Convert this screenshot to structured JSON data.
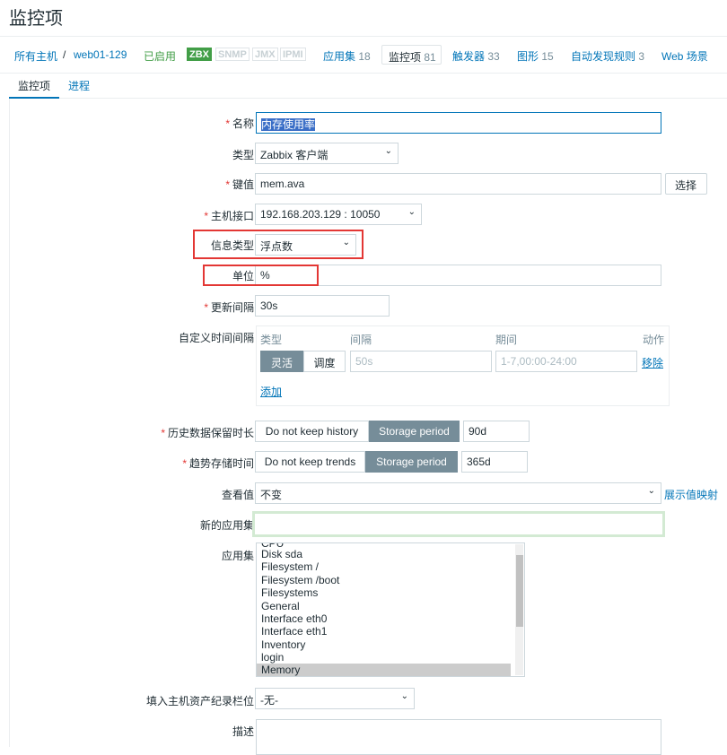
{
  "page": {
    "title": "监控项"
  },
  "nav": {
    "all_hosts": "所有主机",
    "sep": "/",
    "host": "web01-129",
    "enabled": "已启用",
    "badges": [
      "ZBX",
      "SNMP",
      "JMX",
      "IPMI"
    ],
    "apps_label": "应用集",
    "apps_count": "18",
    "items_label": "监控项",
    "items_count": "81",
    "triggers_label": "触发器",
    "triggers_count": "33",
    "graphs_label": "图形",
    "graphs_count": "15",
    "discovery_label": "自动发现规则",
    "discovery_count": "3",
    "web_label": "Web 场景"
  },
  "tabs": {
    "item": "监控项",
    "process": "进程"
  },
  "form": {
    "name_label": "名称",
    "name_value": "内存使用率",
    "type_label": "类型",
    "type_value": "Zabbix 客户端",
    "key_label": "键值",
    "key_value": "mem.ava",
    "select_button": "选择",
    "interface_label": "主机接口",
    "interface_value": "192.168.203.129 : 10050",
    "info_type_label": "信息类型",
    "info_type_value": "浮点数",
    "units_label": "单位",
    "units_value": "%",
    "interval_label": "更新间隔",
    "interval_value": "30s",
    "custom_label": "自定义时间间隔",
    "custom": {
      "col_type": "类型",
      "col_interval": "间隔",
      "col_period": "期间",
      "col_action": "动作",
      "flexible": "灵活",
      "scheduling": "调度",
      "interval_placeholder": "50s",
      "period_placeholder": "1-7,00:00-24:00",
      "remove": "移除",
      "add": "添加"
    },
    "history_label": "历史数据保留时长",
    "history_no": "Do not keep history",
    "history_period": "Storage period",
    "history_value": "90d",
    "trends_label": "趋势存储时间",
    "trends_no": "Do not keep trends",
    "trends_period": "Storage period",
    "trends_value": "365d",
    "valuemap_label": "查看值",
    "valuemap_value": "不变",
    "valuemap_link": "展示值映射",
    "new_app_label": "新的应用集",
    "new_app_value": "",
    "apps_label": "应用集",
    "apps_list": [
      "CPU",
      "Disk sda",
      "Filesystem /",
      "Filesystem /boot",
      "Filesystems",
      "General",
      "Interface eth0",
      "Interface eth1",
      "Inventory",
      "login",
      "Memory"
    ],
    "inventory_label": "填入主机资产纪录栏位",
    "inventory_value": "-无-",
    "desc_label": "描述"
  },
  "colors": {
    "link": "#0275b8",
    "required": "#e33734",
    "enabled": "#429e47",
    "accent_button": "#768d99",
    "highlight_box": "#e33734"
  }
}
